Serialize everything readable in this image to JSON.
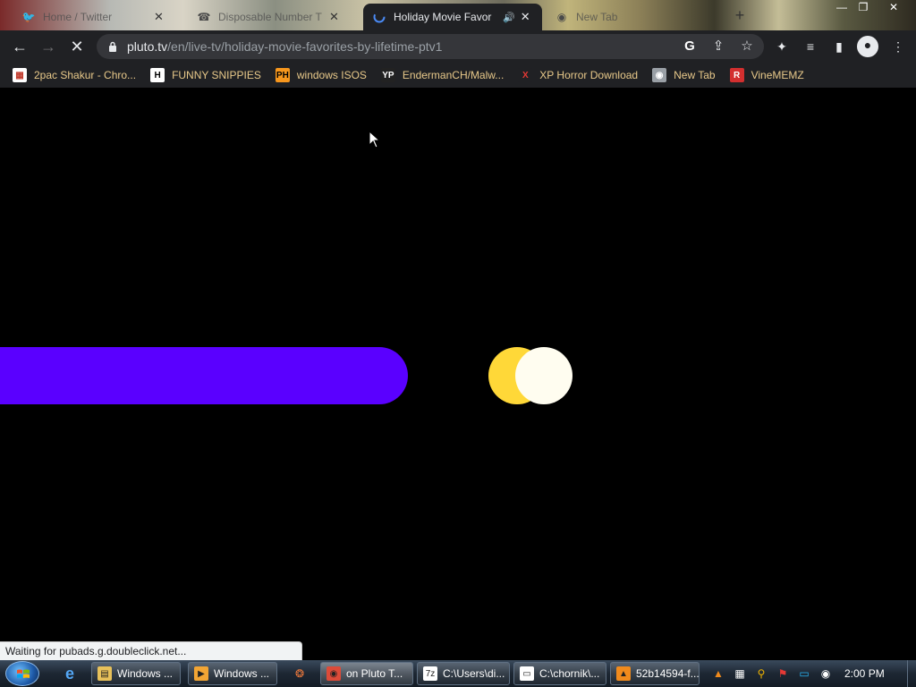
{
  "tabs": [
    {
      "label": "Home / Twitter",
      "icon": "twitter-icon",
      "active": false
    },
    {
      "label": "Disposable Number T",
      "icon": "phone-icon",
      "active": false
    },
    {
      "label": "Holiday Movie Favor",
      "icon": "loading-icon",
      "active": true
    },
    {
      "label": "New Tab",
      "icon": "chrome-icon",
      "active": false
    }
  ],
  "toolbar": {
    "url_host": "pluto.tv",
    "url_path": "/en/live-tv/holiday-movie-favorites-by-lifetime-ptv1"
  },
  "bookmarks": [
    {
      "label": "2pac Shakur - Chro...",
      "icon": "store-icon",
      "icon_bg": "#ffffff",
      "icon_fg": "#c0392b",
      "glyph": "▦"
    },
    {
      "label": "FUNNY SNIPPIES",
      "icon": "h-letter-icon",
      "icon_bg": "#ffffff",
      "icon_fg": "#000000",
      "glyph": "H"
    },
    {
      "label": "windows ISOS",
      "icon": "ph-logo-icon",
      "icon_bg": "#f7971d",
      "icon_fg": "#000000",
      "glyph": "PH"
    },
    {
      "label": "EndermanCH/Malw...",
      "icon": "yp-logo-icon",
      "icon_bg": "#222222",
      "icon_fg": "#ffffff",
      "glyph": "YP"
    },
    {
      "label": "XP Horror Download",
      "icon": "x-logo-icon",
      "icon_bg": "#202124",
      "icon_fg": "#e53935",
      "glyph": "X"
    },
    {
      "label": "New Tab",
      "icon": "chrome-icon",
      "icon_bg": "#9aa0a6",
      "icon_fg": "#ffffff",
      "glyph": "◉"
    },
    {
      "label": "VineMEMZ",
      "icon": "r-logo-icon",
      "icon_bg": "#d32f2f",
      "icon_fg": "#ffffff",
      "glyph": "R"
    }
  ],
  "status_text": "Waiting for pubads.g.doubleclick.net...",
  "taskbar": {
    "buttons": [
      {
        "label": "Windows ...",
        "icon": "folder-icon",
        "icon_bg": "#e8c15a",
        "glyph": "▤",
        "active": false
      },
      {
        "label": "Windows ...",
        "icon": "media-player-icon",
        "icon_bg": "#f2a534",
        "glyph": "▶",
        "active": false
      },
      {
        "label": "on Pluto T...",
        "icon": "chrome-icon",
        "icon_bg": "#dd4b39",
        "glyph": "◉",
        "active": true
      },
      {
        "label": "C:\\Users\\di...",
        "icon": "7zip-icon",
        "icon_bg": "#ffffff",
        "glyph": "7z",
        "active": false
      },
      {
        "label": "C:\\chornik\\...",
        "icon": "window-icon",
        "icon_bg": "#ffffff",
        "glyph": "▭",
        "active": false
      },
      {
        "label": "52b14594-f...",
        "icon": "vlc-icon",
        "icon_bg": "#f08a1c",
        "glyph": "▲",
        "active": false
      }
    ],
    "clock": "2:00 PM"
  },
  "colors": {
    "loader_bar": "#5a00ff",
    "toggle_yellow": "#ffd838",
    "toggle_white": "#fffdf0",
    "bookmark_text": "#e8c98a"
  }
}
